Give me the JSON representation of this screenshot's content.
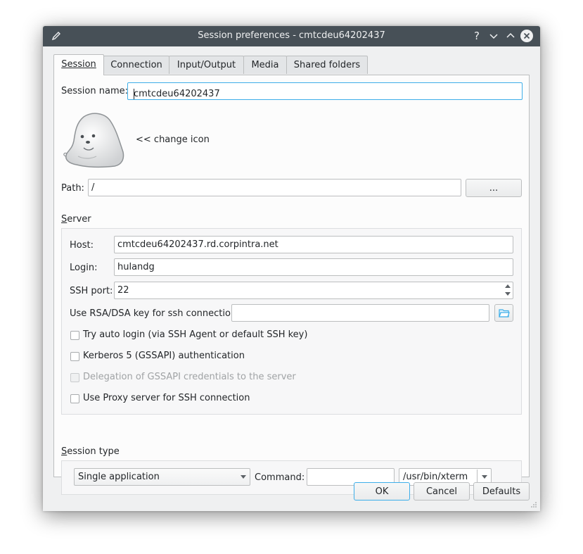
{
  "window": {
    "title": "Session preferences - cmtcdeu64202437"
  },
  "tabs": [
    {
      "label": "Session",
      "underline": "S",
      "active": true
    },
    {
      "label": "Connection",
      "underline": "C"
    },
    {
      "label": "Input/Output",
      "underline": "I"
    },
    {
      "label": "Media",
      "underline": "M"
    },
    {
      "label": "Shared folders",
      "underline": "f"
    }
  ],
  "session": {
    "name_label": "Session name:",
    "name_value": "cmtcdeu64202437",
    "change_icon_label": "<< change icon",
    "path_label": "Path:",
    "path_value": "/",
    "browse_label": "..."
  },
  "server": {
    "group_label": "Server",
    "host_label": "Host:",
    "host_value": "cmtcdeu64202437.rd.corpintra.net",
    "login_label": "Login:",
    "login_value": "hulandg",
    "port_label": "SSH port:",
    "port_value": "22",
    "key_label": "Use RSA/DSA key for ssh connection:",
    "key_value": "",
    "checkboxes": [
      {
        "label": "Try auto login (via SSH Agent or default SSH key)",
        "checked": false,
        "enabled": true
      },
      {
        "label": "Kerberos 5 (GSSAPI) authentication",
        "checked": false,
        "enabled": true
      },
      {
        "label": "Delegation of GSSAPI credentials to the server",
        "checked": false,
        "enabled": false
      },
      {
        "label": "Use Proxy server for SSH connection",
        "checked": false,
        "enabled": true
      }
    ]
  },
  "session_type": {
    "group_label": "Session type",
    "type_value": "Single application",
    "command_label": "Command:",
    "command_value": "",
    "app_value": "/usr/bin/xterm"
  },
  "buttons": {
    "ok": "OK",
    "cancel": "Cancel",
    "defaults": "Defaults"
  },
  "colors": {
    "titlebar": "#475057",
    "focus": "#3daee9",
    "window": "#eff0f1"
  }
}
